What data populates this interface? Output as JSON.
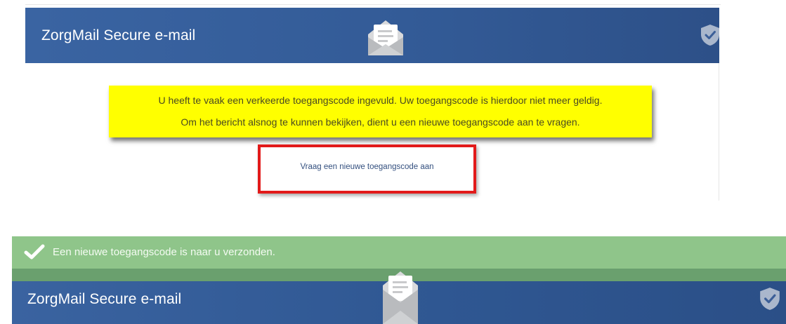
{
  "top": {
    "header": {
      "title": "ZorgMail Secure e-mail"
    },
    "warning": {
      "line1": "U heeft te vaak een verkeerde toegangscode ingevuld. Uw toegangscode is hierdoor niet meer geldig.",
      "line2": "Om het bericht alsnog te kunnen bekijken, dient u een nieuwe toegangscode aan te vragen."
    },
    "request_link": "Vraag een nieuwe toegangscode aan"
  },
  "bottom": {
    "success_message": "Een nieuwe toegangscode is naar u verzonden.",
    "header": {
      "title": "ZorgMail Secure e-mail"
    }
  },
  "icons": {
    "envelope": "envelope-open-icon",
    "shield": "shield-check-icon",
    "check": "checkmark-icon"
  },
  "colors": {
    "header_blue": "#355f9c",
    "warning_yellow": "#ffff00",
    "highlight_red": "#e21a1a",
    "success_green": "#8fc58a"
  }
}
